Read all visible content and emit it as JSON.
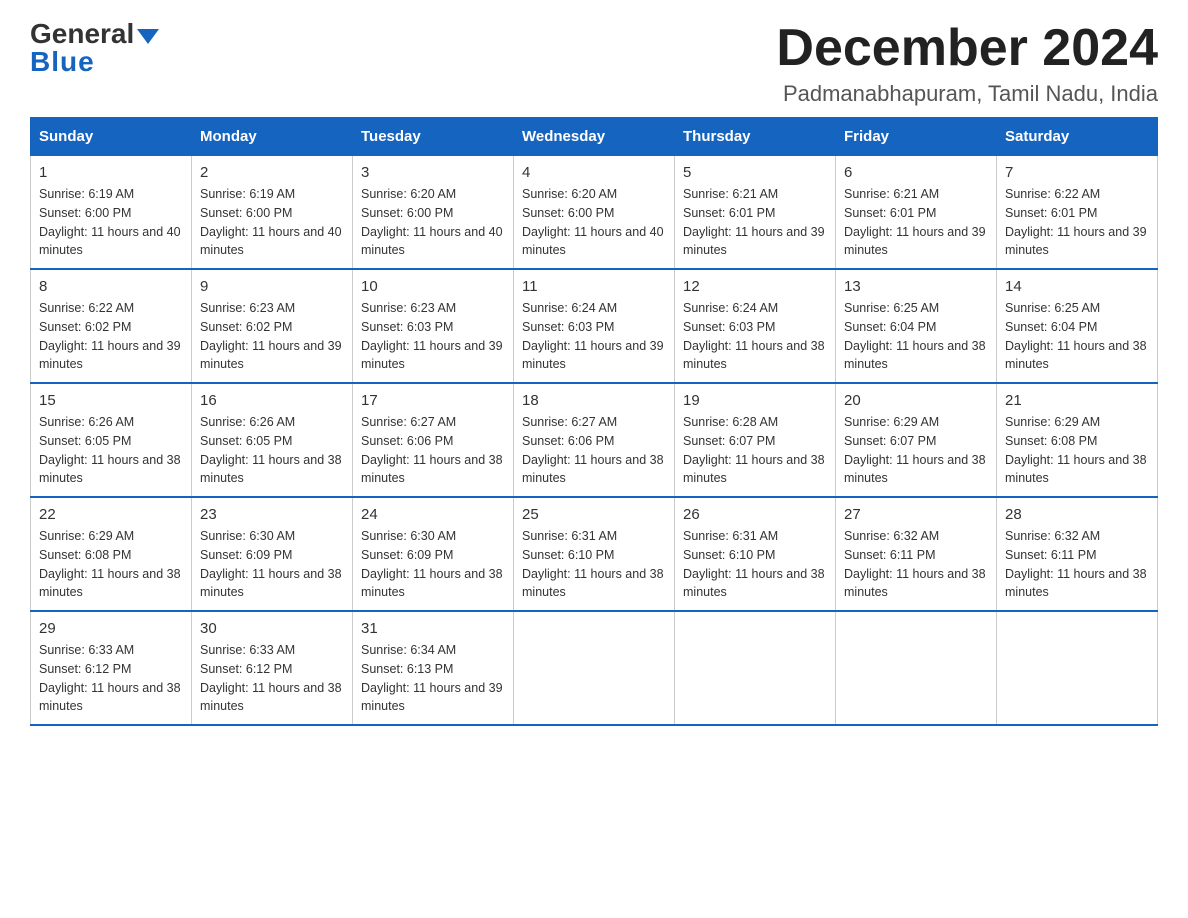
{
  "header": {
    "logo": {
      "general_text": "General",
      "blue_text": "Blue"
    },
    "title": "December 2024",
    "subtitle": "Padmanabhapuram, Tamil Nadu, India"
  },
  "calendar": {
    "days_of_week": [
      "Sunday",
      "Monday",
      "Tuesday",
      "Wednesday",
      "Thursday",
      "Friday",
      "Saturday"
    ],
    "weeks": [
      [
        {
          "day": "1",
          "sunrise": "6:19 AM",
          "sunset": "6:00 PM",
          "daylight": "11 hours and 40 minutes."
        },
        {
          "day": "2",
          "sunrise": "6:19 AM",
          "sunset": "6:00 PM",
          "daylight": "11 hours and 40 minutes."
        },
        {
          "day": "3",
          "sunrise": "6:20 AM",
          "sunset": "6:00 PM",
          "daylight": "11 hours and 40 minutes."
        },
        {
          "day": "4",
          "sunrise": "6:20 AM",
          "sunset": "6:00 PM",
          "daylight": "11 hours and 40 minutes."
        },
        {
          "day": "5",
          "sunrise": "6:21 AM",
          "sunset": "6:01 PM",
          "daylight": "11 hours and 39 minutes."
        },
        {
          "day": "6",
          "sunrise": "6:21 AM",
          "sunset": "6:01 PM",
          "daylight": "11 hours and 39 minutes."
        },
        {
          "day": "7",
          "sunrise": "6:22 AM",
          "sunset": "6:01 PM",
          "daylight": "11 hours and 39 minutes."
        }
      ],
      [
        {
          "day": "8",
          "sunrise": "6:22 AM",
          "sunset": "6:02 PM",
          "daylight": "11 hours and 39 minutes."
        },
        {
          "day": "9",
          "sunrise": "6:23 AM",
          "sunset": "6:02 PM",
          "daylight": "11 hours and 39 minutes."
        },
        {
          "day": "10",
          "sunrise": "6:23 AM",
          "sunset": "6:03 PM",
          "daylight": "11 hours and 39 minutes."
        },
        {
          "day": "11",
          "sunrise": "6:24 AM",
          "sunset": "6:03 PM",
          "daylight": "11 hours and 39 minutes."
        },
        {
          "day": "12",
          "sunrise": "6:24 AM",
          "sunset": "6:03 PM",
          "daylight": "11 hours and 38 minutes."
        },
        {
          "day": "13",
          "sunrise": "6:25 AM",
          "sunset": "6:04 PM",
          "daylight": "11 hours and 38 minutes."
        },
        {
          "day": "14",
          "sunrise": "6:25 AM",
          "sunset": "6:04 PM",
          "daylight": "11 hours and 38 minutes."
        }
      ],
      [
        {
          "day": "15",
          "sunrise": "6:26 AM",
          "sunset": "6:05 PM",
          "daylight": "11 hours and 38 minutes."
        },
        {
          "day": "16",
          "sunrise": "6:26 AM",
          "sunset": "6:05 PM",
          "daylight": "11 hours and 38 minutes."
        },
        {
          "day": "17",
          "sunrise": "6:27 AM",
          "sunset": "6:06 PM",
          "daylight": "11 hours and 38 minutes."
        },
        {
          "day": "18",
          "sunrise": "6:27 AM",
          "sunset": "6:06 PM",
          "daylight": "11 hours and 38 minutes."
        },
        {
          "day": "19",
          "sunrise": "6:28 AM",
          "sunset": "6:07 PM",
          "daylight": "11 hours and 38 minutes."
        },
        {
          "day": "20",
          "sunrise": "6:29 AM",
          "sunset": "6:07 PM",
          "daylight": "11 hours and 38 minutes."
        },
        {
          "day": "21",
          "sunrise": "6:29 AM",
          "sunset": "6:08 PM",
          "daylight": "11 hours and 38 minutes."
        }
      ],
      [
        {
          "day": "22",
          "sunrise": "6:29 AM",
          "sunset": "6:08 PM",
          "daylight": "11 hours and 38 minutes."
        },
        {
          "day": "23",
          "sunrise": "6:30 AM",
          "sunset": "6:09 PM",
          "daylight": "11 hours and 38 minutes."
        },
        {
          "day": "24",
          "sunrise": "6:30 AM",
          "sunset": "6:09 PM",
          "daylight": "11 hours and 38 minutes."
        },
        {
          "day": "25",
          "sunrise": "6:31 AM",
          "sunset": "6:10 PM",
          "daylight": "11 hours and 38 minutes."
        },
        {
          "day": "26",
          "sunrise": "6:31 AM",
          "sunset": "6:10 PM",
          "daylight": "11 hours and 38 minutes."
        },
        {
          "day": "27",
          "sunrise": "6:32 AM",
          "sunset": "6:11 PM",
          "daylight": "11 hours and 38 minutes."
        },
        {
          "day": "28",
          "sunrise": "6:32 AM",
          "sunset": "6:11 PM",
          "daylight": "11 hours and 38 minutes."
        }
      ],
      [
        {
          "day": "29",
          "sunrise": "6:33 AM",
          "sunset": "6:12 PM",
          "daylight": "11 hours and 38 minutes."
        },
        {
          "day": "30",
          "sunrise": "6:33 AM",
          "sunset": "6:12 PM",
          "daylight": "11 hours and 38 minutes."
        },
        {
          "day": "31",
          "sunrise": "6:34 AM",
          "sunset": "6:13 PM",
          "daylight": "11 hours and 39 minutes."
        },
        null,
        null,
        null,
        null
      ]
    ]
  }
}
